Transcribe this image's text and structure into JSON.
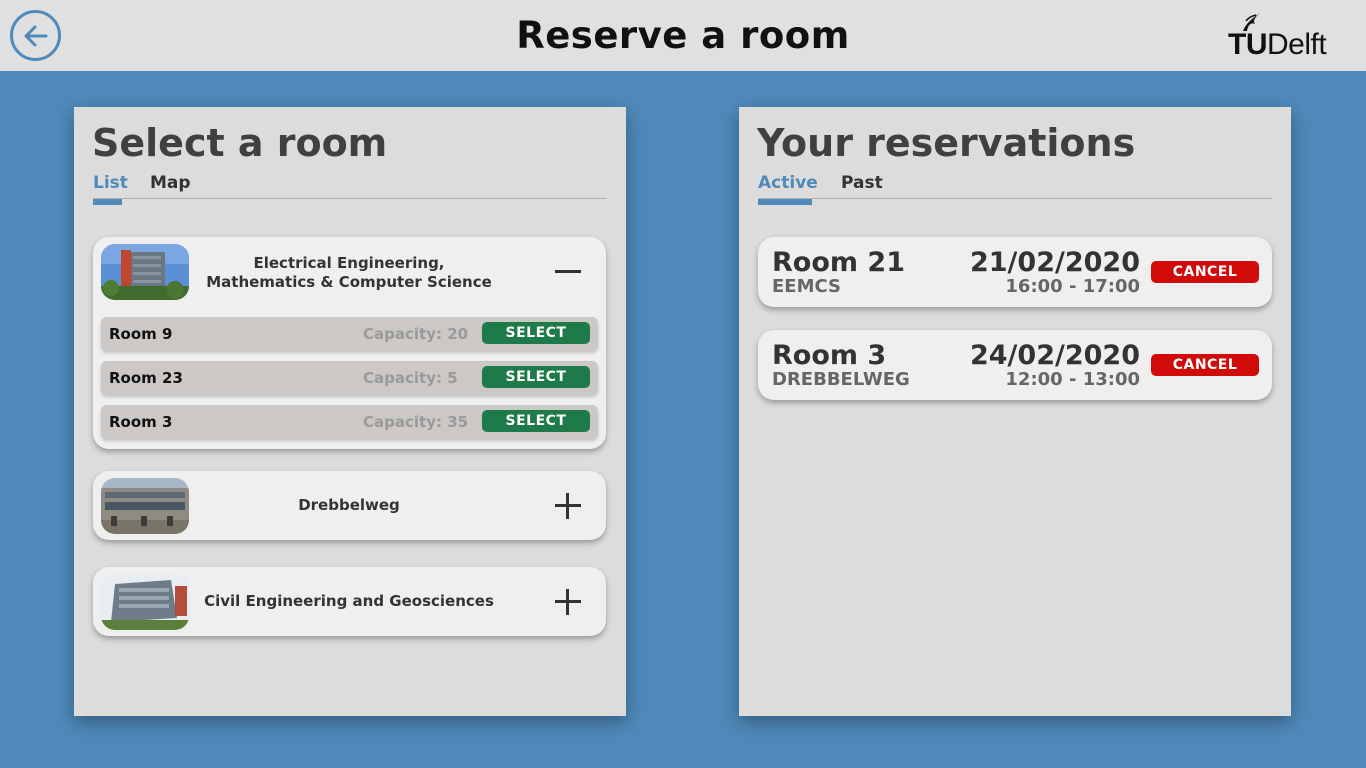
{
  "header": {
    "title": "Reserve a room",
    "logo": {
      "part1": "TU",
      "part2": "Delft"
    },
    "back_icon": "arrow-left-icon"
  },
  "select_panel": {
    "title": "Select a room",
    "tabs": [
      {
        "label": "List",
        "active": true
      },
      {
        "label": "Map",
        "active": false
      }
    ],
    "buildings": [
      {
        "name": "Electrical Engineering, Mathematics & Computer Science",
        "expanded": true,
        "toggle_icon": "minus-icon",
        "rooms": [
          {
            "name": "Room 9",
            "capacity": "Capacity: 20",
            "action": "SELECT"
          },
          {
            "name": "Room 23",
            "capacity": "Capacity: 5",
            "action": "SELECT"
          },
          {
            "name": "Room 3",
            "capacity": "Capacity: 35",
            "action": "SELECT"
          }
        ]
      },
      {
        "name": "Drebbelweg",
        "expanded": false,
        "toggle_icon": "plus-icon",
        "rooms": []
      },
      {
        "name": "Civil Engineering and Geosciences",
        "expanded": false,
        "toggle_icon": "plus-icon",
        "rooms": []
      }
    ]
  },
  "reservations_panel": {
    "title": "Your reservations",
    "tabs": [
      {
        "label": "Active",
        "active": true
      },
      {
        "label": "Past",
        "active": false
      }
    ],
    "items": [
      {
        "room": "Room 21",
        "building": "EEMCS",
        "date": "21/02/2020",
        "time": "16:00 - 17:00",
        "action": "CANCEL"
      },
      {
        "room": "Room 3",
        "building": "DREBBELWEG",
        "date": "24/02/2020",
        "time": "12:00 - 13:00",
        "action": "CANCEL"
      }
    ]
  },
  "colors": {
    "background": "#4f8abb",
    "accent": "#4f8abb",
    "select": "#1f7a49",
    "cancel": "#d10a0a"
  }
}
